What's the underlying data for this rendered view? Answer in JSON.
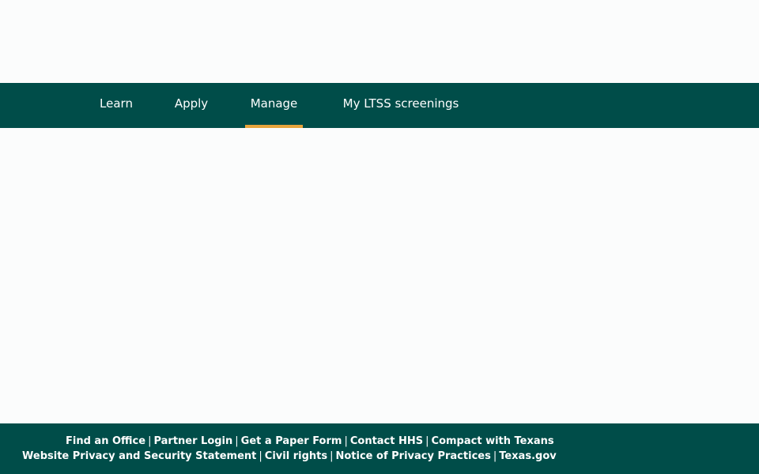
{
  "nav": {
    "items": [
      {
        "label": "Learn",
        "active": false
      },
      {
        "label": "Apply",
        "active": false
      },
      {
        "label": "Manage",
        "active": true
      },
      {
        "label": "My LTSS screenings",
        "active": false
      }
    ]
  },
  "footer": {
    "separator": "|",
    "line1": [
      "Find an Office",
      "Partner Login",
      "Get a Paper Form",
      "Contact HHS",
      "Compact with Texans"
    ],
    "line2": [
      "Website Privacy and Security Statement",
      "Civil rights",
      "Notice of Privacy Practices",
      "Texas.gov"
    ]
  },
  "colors": {
    "nav_background": "#004d49",
    "active_underline": "#e7a43c",
    "page_background": "#fbfcfc",
    "footer_background": "#004d49"
  }
}
